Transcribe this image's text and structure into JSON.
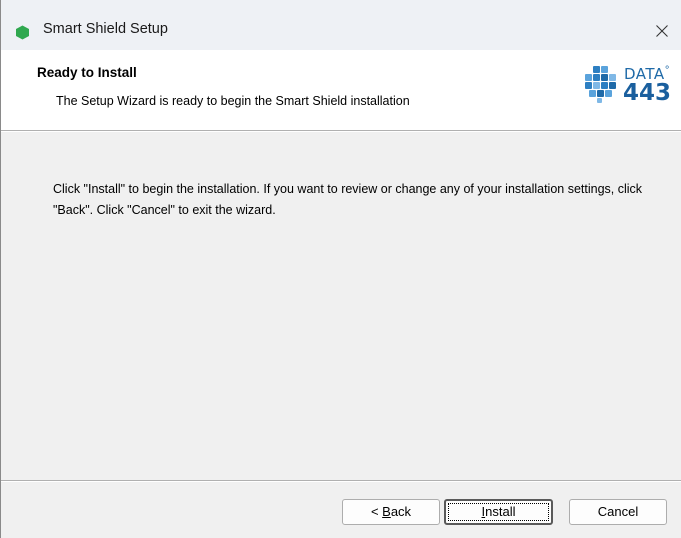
{
  "window": {
    "title": "Smart Shield Setup",
    "close_glyph": "×"
  },
  "header": {
    "title": "Ready to Install",
    "subtitle": "The Setup Wizard is ready to begin the Smart Shield installation",
    "logo": {
      "word": "DATA",
      "mark": "°",
      "number": "443"
    }
  },
  "body": {
    "message": "Click \"Install\" to begin the installation.  If you want to review or change any of your installation settings, click \"Back\".  Click \"Cancel\" to exit the wizard."
  },
  "buttons": {
    "back": {
      "prefix": "< ",
      "mnemonic": "B",
      "rest": "ack",
      "label": "< Back"
    },
    "install": {
      "mnemonic": "I",
      "rest": "nstall",
      "label": "Install"
    },
    "cancel": {
      "label": "Cancel"
    }
  },
  "colors": {
    "title_icon": "#2fa84f",
    "logo_blue": "#1f6aa8",
    "window_bg": "#f0f0f0"
  },
  "icons": {
    "title_icon": "green-hexagon-icon",
    "close": "close-icon",
    "logo": "data443-logo-icon"
  }
}
